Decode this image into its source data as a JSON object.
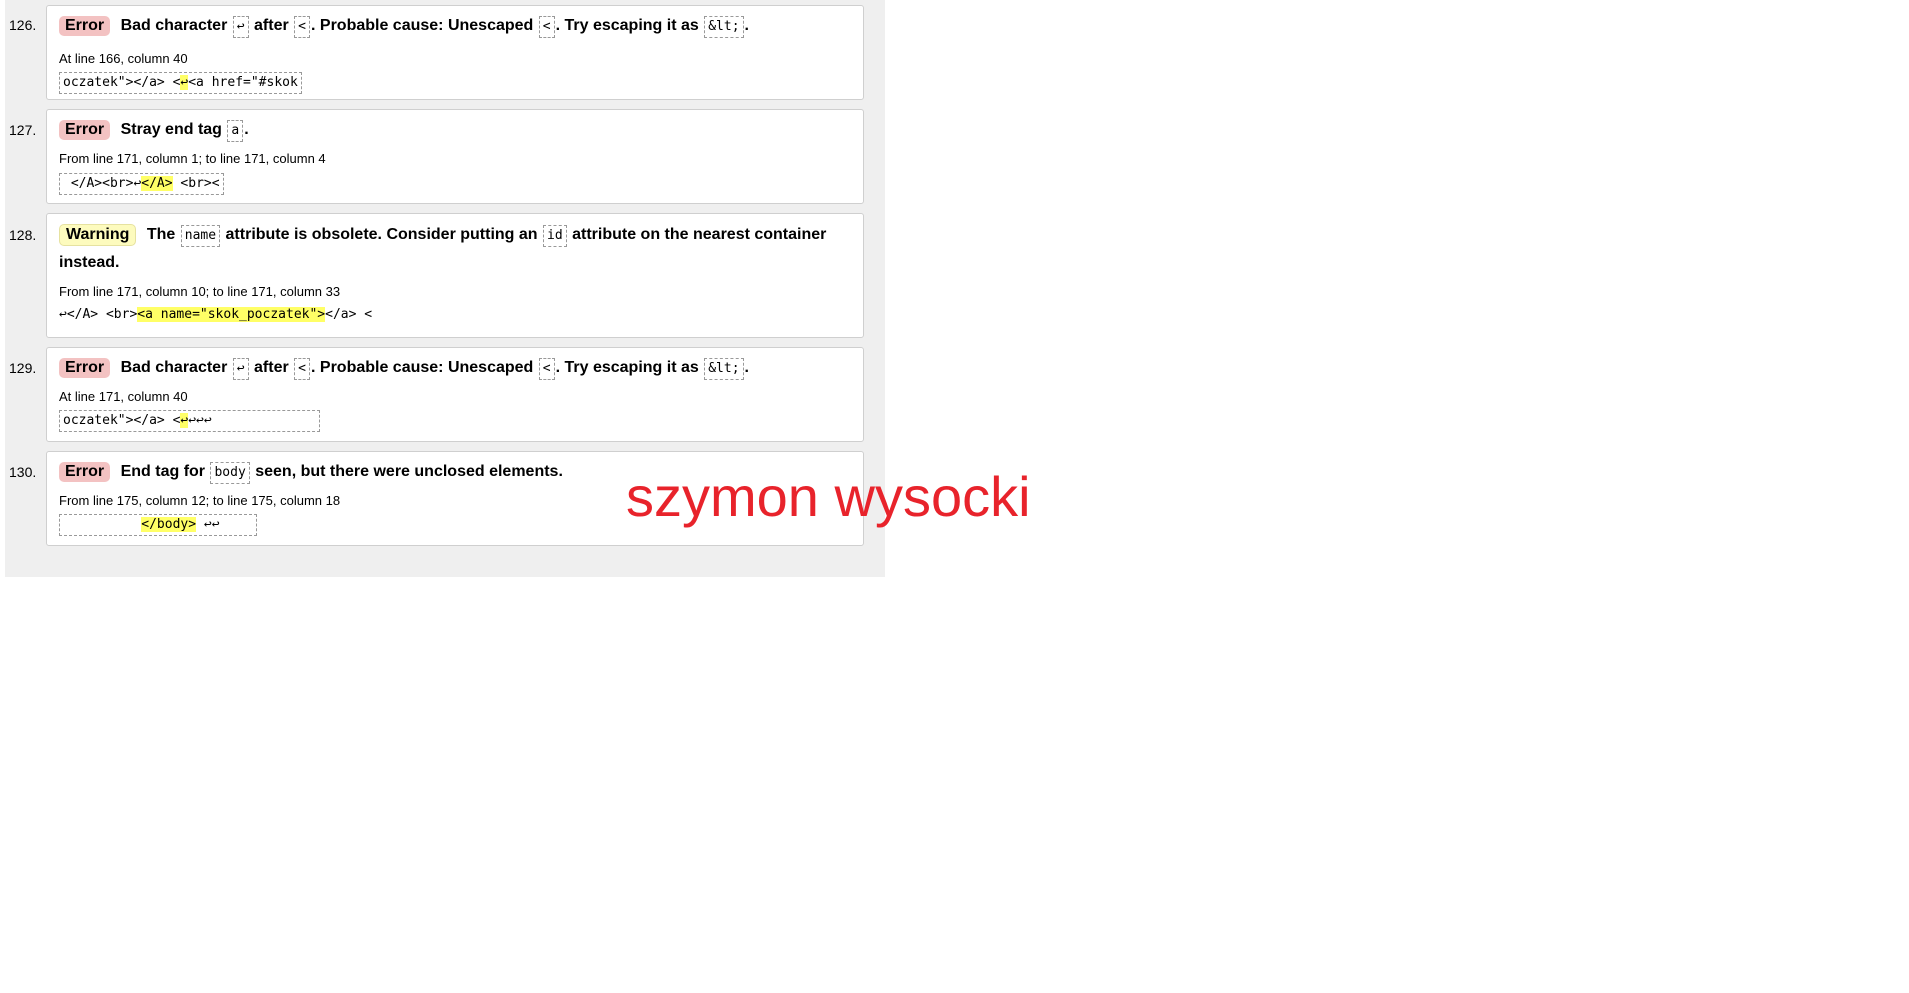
{
  "messages": [
    {
      "number": "126.",
      "type": "Error",
      "parts": [
        "Bad character",
        "↩",
        "after",
        "<",
        ". Probable cause: Unescaped",
        "<",
        ". Try escaping it as",
        "&lt;",
        "."
      ],
      "location": "At line 166, column 40",
      "extract_pre": "oczatek\"></a> <",
      "extract_hl": "↩",
      "extract_post": "<a href=\"#skok"
    },
    {
      "number": "127.",
      "type": "Error",
      "parts": [
        "Stray end tag",
        "a",
        "."
      ],
      "location": "From line 171, column 1; to line 171, column 4",
      "extract_pre": " </A><br>↩",
      "extract_hl": "</A>",
      "extract_post": " <br><"
    },
    {
      "number": "128.",
      "type": "Warning",
      "parts": [
        "The",
        "name",
        "attribute is obsolete. Consider putting an",
        "id",
        "attribute on the nearest container instead."
      ],
      "location": "From line 171, column 10; to line 171, column 33",
      "extract_pre": "↩</A> <br>",
      "extract_hl": "<a name=\"skok_poczatek\">",
      "extract_post": "</a> <"
    },
    {
      "number": "129.",
      "type": "Error",
      "parts": [
        "Bad character",
        "↩",
        "after",
        "<",
        ". Probable cause: Unescaped",
        "<",
        ". Try escaping it as",
        "&lt;",
        "."
      ],
      "location": "At line 171, column 40",
      "extract_pre": "oczatek\"></a> <",
      "extract_hl": "↩",
      "extract_post": "↩↩↩"
    },
    {
      "number": "130.",
      "type": "Error",
      "parts": [
        "End tag for",
        "body",
        "seen, but there were unclosed elements."
      ],
      "location": "From line 175, column 12; to line 175, column 18",
      "extract_pre": "          ",
      "extract_hl": "</body>",
      "extract_post": " ↩↩"
    }
  ],
  "signature": "szymon wysocki",
  "colors": {
    "error_badge": "#f3c2c2",
    "warning_badge": "#fdfbbe",
    "highlight": "#ffff66",
    "signature": "#e8232b"
  }
}
